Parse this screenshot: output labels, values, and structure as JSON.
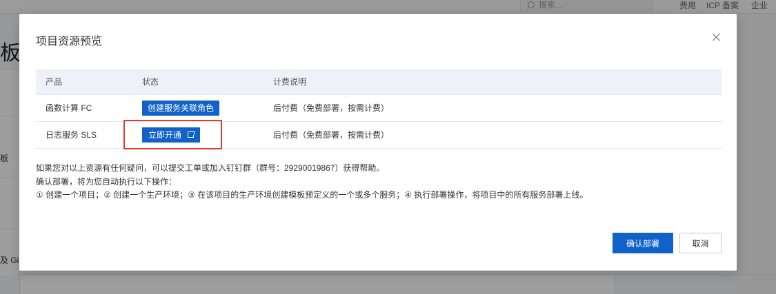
{
  "background": {
    "search_placeholder": "搜索...",
    "nav": [
      "费用",
      "ICP 备案",
      "企业"
    ],
    "heading_fragment": "板",
    "left_fragment": "板",
    "left_bottom_fragment": "及 Gi"
  },
  "dialog": {
    "title": "项目资源预览",
    "table": {
      "headers": [
        "产品",
        "状态",
        "计费说明"
      ],
      "rows": [
        {
          "product": "函数计算 FC",
          "action": "创建服务关联角色",
          "billing": "后付费（免费部署，按需计费）"
        },
        {
          "product": "日志服务 SLS",
          "action": "立即开通",
          "billing": "后付费（免费部署，按需计费）"
        }
      ]
    },
    "notes": [
      "如果您对以上资源有任何疑问，可以提交工单或加入钉钉群（群号：29290019867）获得帮助。",
      "确认部署，将为您自动执行以下操作：",
      "① 创建一个项目；② 创建一个生产环境；③ 在该项目的生产环境创建模板预定义的一个或多个服务；④ 执行部署操作，将项目中的所有服务部署上线。"
    ],
    "confirm_label": "确认部署",
    "cancel_label": "取消"
  },
  "colors": {
    "primary": "#1062c8",
    "highlight": "#e23a2d"
  },
  "icons": [
    "search-icon",
    "close-icon",
    "external-link-icon"
  ]
}
